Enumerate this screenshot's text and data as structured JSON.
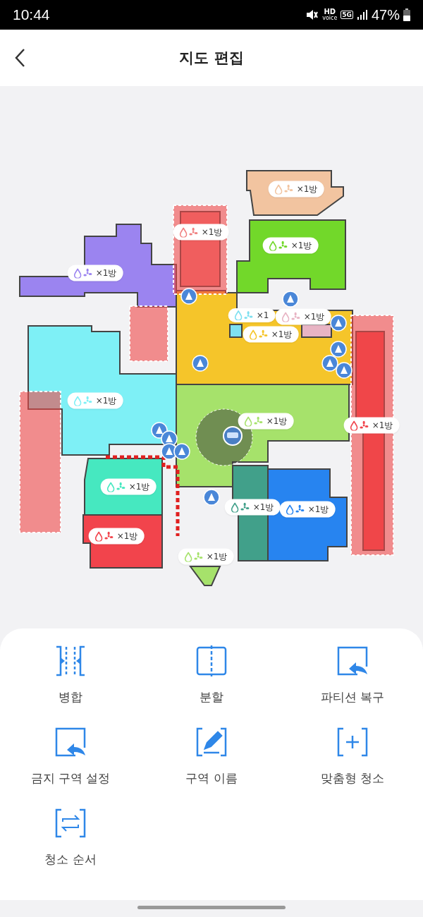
{
  "status_bar": {
    "time": "10:44",
    "hd": "HD",
    "voice": "voice",
    "network": "5G",
    "battery": "47%"
  },
  "header": {
    "title": "지도 편집"
  },
  "map": {
    "rooms": [
      {
        "color": "#f2c4a0",
        "label": "×1방"
      },
      {
        "color": "#f08080",
        "label": "×1방"
      },
      {
        "color": "#72d82a",
        "label": "×1방"
      },
      {
        "color": "#9b84f0",
        "label": "×1방"
      },
      {
        "color": "#7ee0f0",
        "label": "×1"
      },
      {
        "color": "#e8b4c4",
        "label": "×1방"
      },
      {
        "color": "#f5c52a",
        "label": "×1방"
      },
      {
        "color": "#7ef0f6",
        "label": "×1방"
      },
      {
        "color": "#a6e26b",
        "label": "×1방"
      },
      {
        "color": "#f0444c",
        "label": "×1방"
      },
      {
        "color": "#46e8c0",
        "label": "×1방"
      },
      {
        "color": "#f2444c",
        "label": "×1방"
      },
      {
        "color": "#41a08a",
        "label": "×1방"
      },
      {
        "color": "#2784f0",
        "label": "×1방"
      },
      {
        "color": "#a6e26b",
        "label": "×1방"
      }
    ]
  },
  "actions": [
    {
      "kind": "merge",
      "label": "병합"
    },
    {
      "kind": "split",
      "label": "분할"
    },
    {
      "kind": "restore",
      "label": "파티션 복구"
    },
    {
      "kind": "forbid",
      "label": "금지 구역 설정"
    },
    {
      "kind": "rename",
      "label": "구역 이름"
    },
    {
      "kind": "custom",
      "label": "맞춤형 청소"
    },
    {
      "kind": "order",
      "label": "청소 순서"
    }
  ]
}
